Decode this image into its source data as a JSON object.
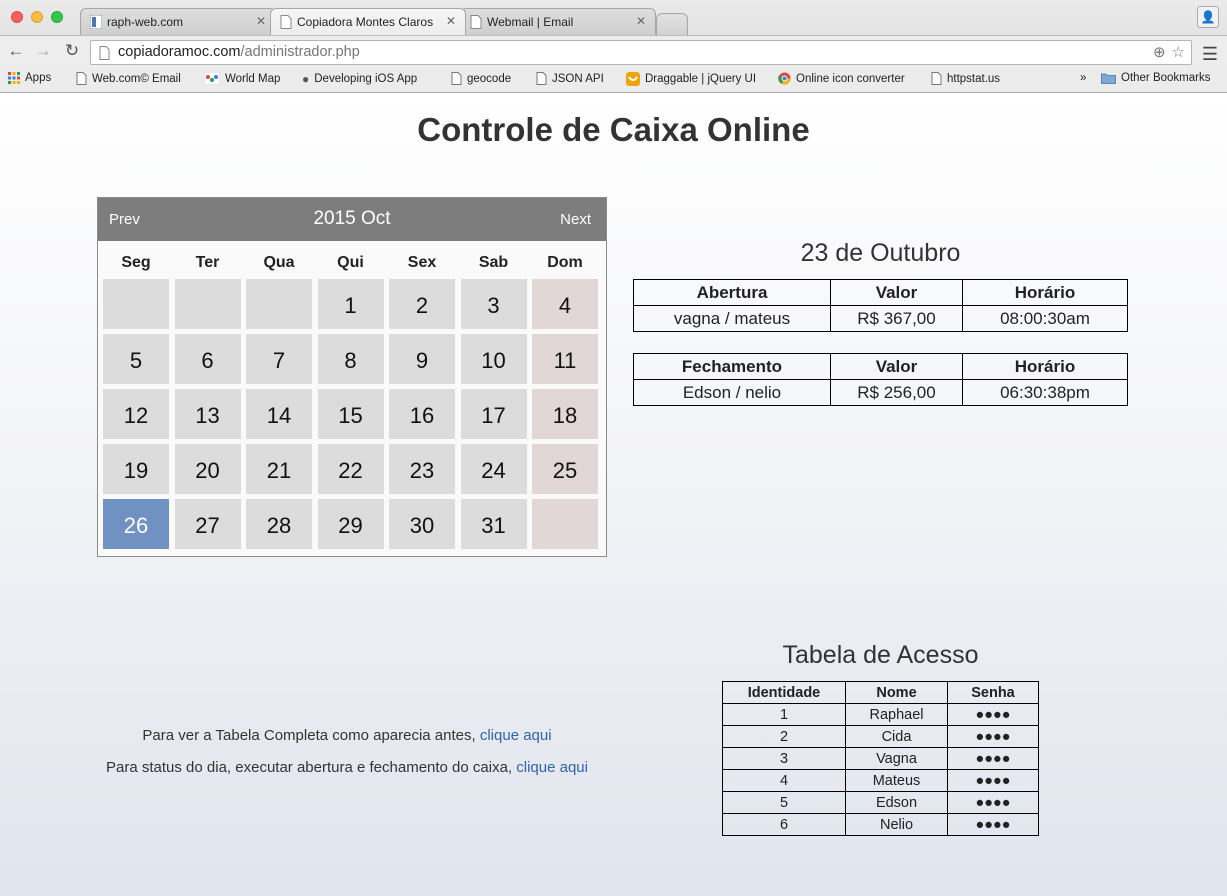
{
  "browser": {
    "tabs": [
      {
        "label": "raph-web.com",
        "active": false
      },
      {
        "label": "Copiadora Montes Claros",
        "active": true
      },
      {
        "label": "Webmail | Email",
        "active": false
      }
    ],
    "url_host": "copiadoramoc.com",
    "url_path": "/administrador.php",
    "bookmarks": [
      {
        "label": "Apps",
        "icon": "apps-grid-icon"
      },
      {
        "label": "Web.com© Email",
        "icon": "page-icon"
      },
      {
        "label": "World Map",
        "icon": "world-map-icon"
      },
      {
        "label": "Developing iOS App",
        "icon": "apple-icon"
      },
      {
        "label": "geocode",
        "icon": "page-icon"
      },
      {
        "label": "JSON API",
        "icon": "page-icon"
      },
      {
        "label": "Draggable | jQuery UI",
        "icon": "jquery-icon"
      },
      {
        "label": "Online icon converter",
        "icon": "chrome-icon"
      },
      {
        "label": "httpstat.us",
        "icon": "page-icon"
      }
    ],
    "overflow": "»",
    "other_bookmarks": "Other Bookmarks"
  },
  "page": {
    "title": "Controle de Caixa Online"
  },
  "calendar": {
    "prev": "Prev",
    "next": "Next",
    "month_label": "2015 Oct",
    "weekdays": [
      "Seg",
      "Ter",
      "Qua",
      "Qui",
      "Sex",
      "Sab",
      "Dom"
    ],
    "leading_blanks": 3,
    "days": [
      "1",
      "2",
      "3",
      "4",
      "5",
      "6",
      "7",
      "8",
      "9",
      "10",
      "11",
      "12",
      "13",
      "14",
      "15",
      "16",
      "17",
      "18",
      "19",
      "20",
      "21",
      "22",
      "23",
      "24",
      "25",
      "26",
      "27",
      "28",
      "29",
      "30",
      "31"
    ],
    "today": "26",
    "colors": {
      "header": "#7d7d7d",
      "day": "#dcdcdc",
      "weekend": "#e1d7d7",
      "today": "#6f92c2"
    }
  },
  "detail": {
    "title": "23 de Outubro",
    "opening": {
      "headers": [
        "Abertura",
        "Valor",
        "Horário"
      ],
      "row": [
        "vagna / mateus",
        "R$ 367,00",
        "08:00:30am"
      ]
    },
    "closing": {
      "headers": [
        "Fechamento",
        "Valor",
        "Horário"
      ],
      "row": [
        "Edson / nelio",
        "R$ 256,00",
        "06:30:38pm"
      ]
    }
  },
  "links": {
    "line1_text": "Para ver a Tabela Completa como aparecia antes, ",
    "line1_link": "clique aqui",
    "line2_text": "Para status do dia, executar abertura e fechamento do caixa, ",
    "line2_link": "clique aqui"
  },
  "access": {
    "title": "Tabela de Acesso",
    "headers": [
      "Identidade",
      "Nome",
      "Senha"
    ],
    "rows": [
      [
        "1",
        "Raphael",
        "●●●●"
      ],
      [
        "2",
        "Cida",
        "●●●●"
      ],
      [
        "3",
        "Vagna",
        "●●●●"
      ],
      [
        "4",
        "Mateus",
        "●●●●"
      ],
      [
        "5",
        "Edson",
        "●●●●"
      ],
      [
        "6",
        "Nelio",
        "●●●●"
      ]
    ]
  }
}
